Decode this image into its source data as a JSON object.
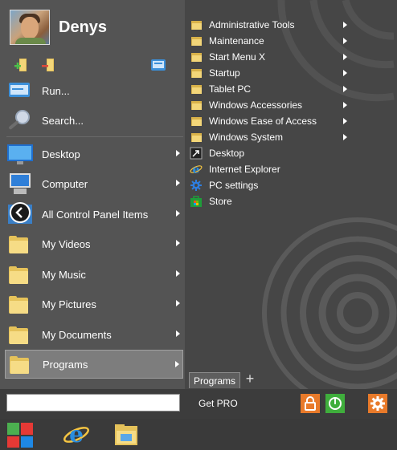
{
  "user": {
    "name": "Denys"
  },
  "quick_actions": [
    "add-user-icon",
    "remove-user-icon",
    "display-icon"
  ],
  "left_items": [
    {
      "label": "Run...",
      "icon": "run-icon",
      "arrow": false
    },
    {
      "label": "Search...",
      "icon": "search-icon",
      "arrow": false
    },
    {
      "label": "Desktop",
      "icon": "desktop-icon",
      "arrow": true
    },
    {
      "label": "Computer",
      "icon": "computer-icon",
      "arrow": true
    },
    {
      "label": "All Control Panel Items",
      "icon": "control-panel-icon",
      "arrow": true
    },
    {
      "label": "My Videos",
      "icon": "folder-icon",
      "arrow": true
    },
    {
      "label": "My Music",
      "icon": "folder-icon",
      "arrow": true
    },
    {
      "label": "My Pictures",
      "icon": "folder-icon",
      "arrow": true
    },
    {
      "label": "My Documents",
      "icon": "folder-icon",
      "arrow": true
    },
    {
      "label": "Programs",
      "icon": "folder-icon",
      "arrow": true,
      "selected": true
    }
  ],
  "right_items": [
    {
      "label": "Administrative Tools",
      "icon": "folder-icon",
      "arrow": true
    },
    {
      "label": "Maintenance",
      "icon": "folder-icon",
      "arrow": true
    },
    {
      "label": "Start Menu X",
      "icon": "folder-icon",
      "arrow": true
    },
    {
      "label": "Startup",
      "icon": "folder-icon",
      "arrow": true
    },
    {
      "label": "Tablet PC",
      "icon": "folder-icon",
      "arrow": true
    },
    {
      "label": "Windows Accessories",
      "icon": "folder-icon",
      "arrow": true
    },
    {
      "label": "Windows Ease of Access",
      "icon": "folder-icon",
      "arrow": true
    },
    {
      "label": "Windows System",
      "icon": "folder-icon",
      "arrow": true
    },
    {
      "label": "Desktop",
      "icon": "shortcut-icon",
      "arrow": false
    },
    {
      "label": "Internet Explorer",
      "icon": "ie-icon",
      "arrow": false
    },
    {
      "label": "PC settings",
      "icon": "gear-icon",
      "arrow": false
    },
    {
      "label": "Store",
      "icon": "store-icon",
      "arrow": false
    }
  ],
  "tabs": {
    "programs": "Programs",
    "add": "+"
  },
  "bottom": {
    "search_value": "",
    "get_pro": "Get PRO"
  },
  "taskbar": [
    "start-menu-x-icon",
    "internet-explorer-icon",
    "file-explorer-icon"
  ],
  "colors": {
    "accent_orange": "#e87a2a",
    "accent_green": "#3fae3c",
    "folder": "#f6dc86",
    "menu_bg": "#545454"
  }
}
